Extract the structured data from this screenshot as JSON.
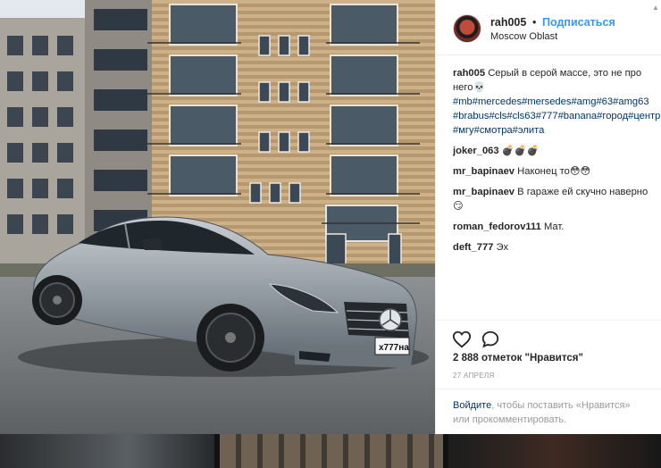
{
  "post": {
    "username": "rah005",
    "dot": "•",
    "follow_label": "Подписаться",
    "location": "Moscow Oblast"
  },
  "caption": {
    "username": "rah005",
    "text": "Серый в серой массе, это не про него💀",
    "hashtags": [
      "#mb",
      "#mercedes",
      "#mersedes",
      "#amg",
      "#63",
      "#amg63",
      "#brabus",
      "#cls",
      "#cls63",
      "#777",
      "#banana",
      "#город",
      "#центр",
      "#мгу",
      "#смотра",
      "#элита"
    ]
  },
  "comments": [
    {
      "username": "joker_063",
      "text": "💣💣💣"
    },
    {
      "username": "mr_bapinaev",
      "text": "Наконец то😳😳"
    },
    {
      "username": "mr_bapinaev",
      "text": "В гараже ей скучно наверно😏"
    },
    {
      "username": "roman_fedorov111",
      "text": "Мат."
    },
    {
      "username": "deft_777",
      "text": "Эх"
    }
  ],
  "likes": "2 888 отметок \"Нравится\"",
  "date": "27 АПРЕЛЯ",
  "login_prompt": {
    "link": "Войдите",
    "text": ", чтобы поставить «Нравится» или прокомментировать."
  },
  "photo": {
    "plate": "х777на"
  },
  "icons": {
    "like": "heart-icon",
    "comment": "comment-icon",
    "scroll": "scroll-up-icon"
  },
  "colors": {
    "link": "#003569",
    "follow": "#3897f0",
    "muted": "#999999"
  }
}
